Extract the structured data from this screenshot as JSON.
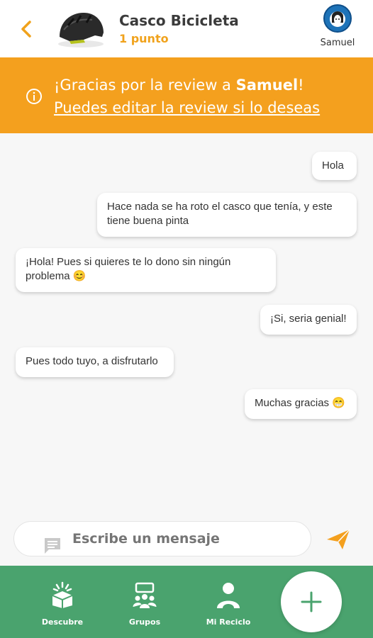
{
  "header": {
    "product_name": "Casco Bicicleta",
    "product_points": "1 punto",
    "user_name": "Samuel"
  },
  "banner": {
    "thanks_prefix": "¡Gracias por la review a ",
    "thanks_user": "Samuel",
    "thanks_suffix": "!",
    "edit_link": "Puedes editar la review si lo deseas"
  },
  "messages": [
    {
      "side": "right",
      "text": "Hola"
    },
    {
      "side": "right",
      "text": "Hace nada se ha roto el casco que tenía, y este tiene buena pinta"
    },
    {
      "side": "left",
      "text": "¡Hola! Pues si quieres te lo dono sin ningún problema 😊"
    },
    {
      "side": "right",
      "text": "¡Si, seria genial!"
    },
    {
      "side": "left",
      "text": "Pues todo tuyo, a disfrutarlo"
    },
    {
      "side": "right",
      "text": "Muchas gracias 😁"
    }
  ],
  "composer": {
    "placeholder": "Escribe un mensaje"
  },
  "nav": {
    "items": [
      {
        "label": "Descubre",
        "icon": "box-icon"
      },
      {
        "label": "Grupos",
        "icon": "group-icon"
      },
      {
        "label": "Mi Reciclo",
        "icon": "person-icon"
      }
    ],
    "fab_icon": "plus-icon"
  },
  "colors": {
    "accent_orange": "#f4a01e",
    "nav_green": "#4aa36e"
  }
}
